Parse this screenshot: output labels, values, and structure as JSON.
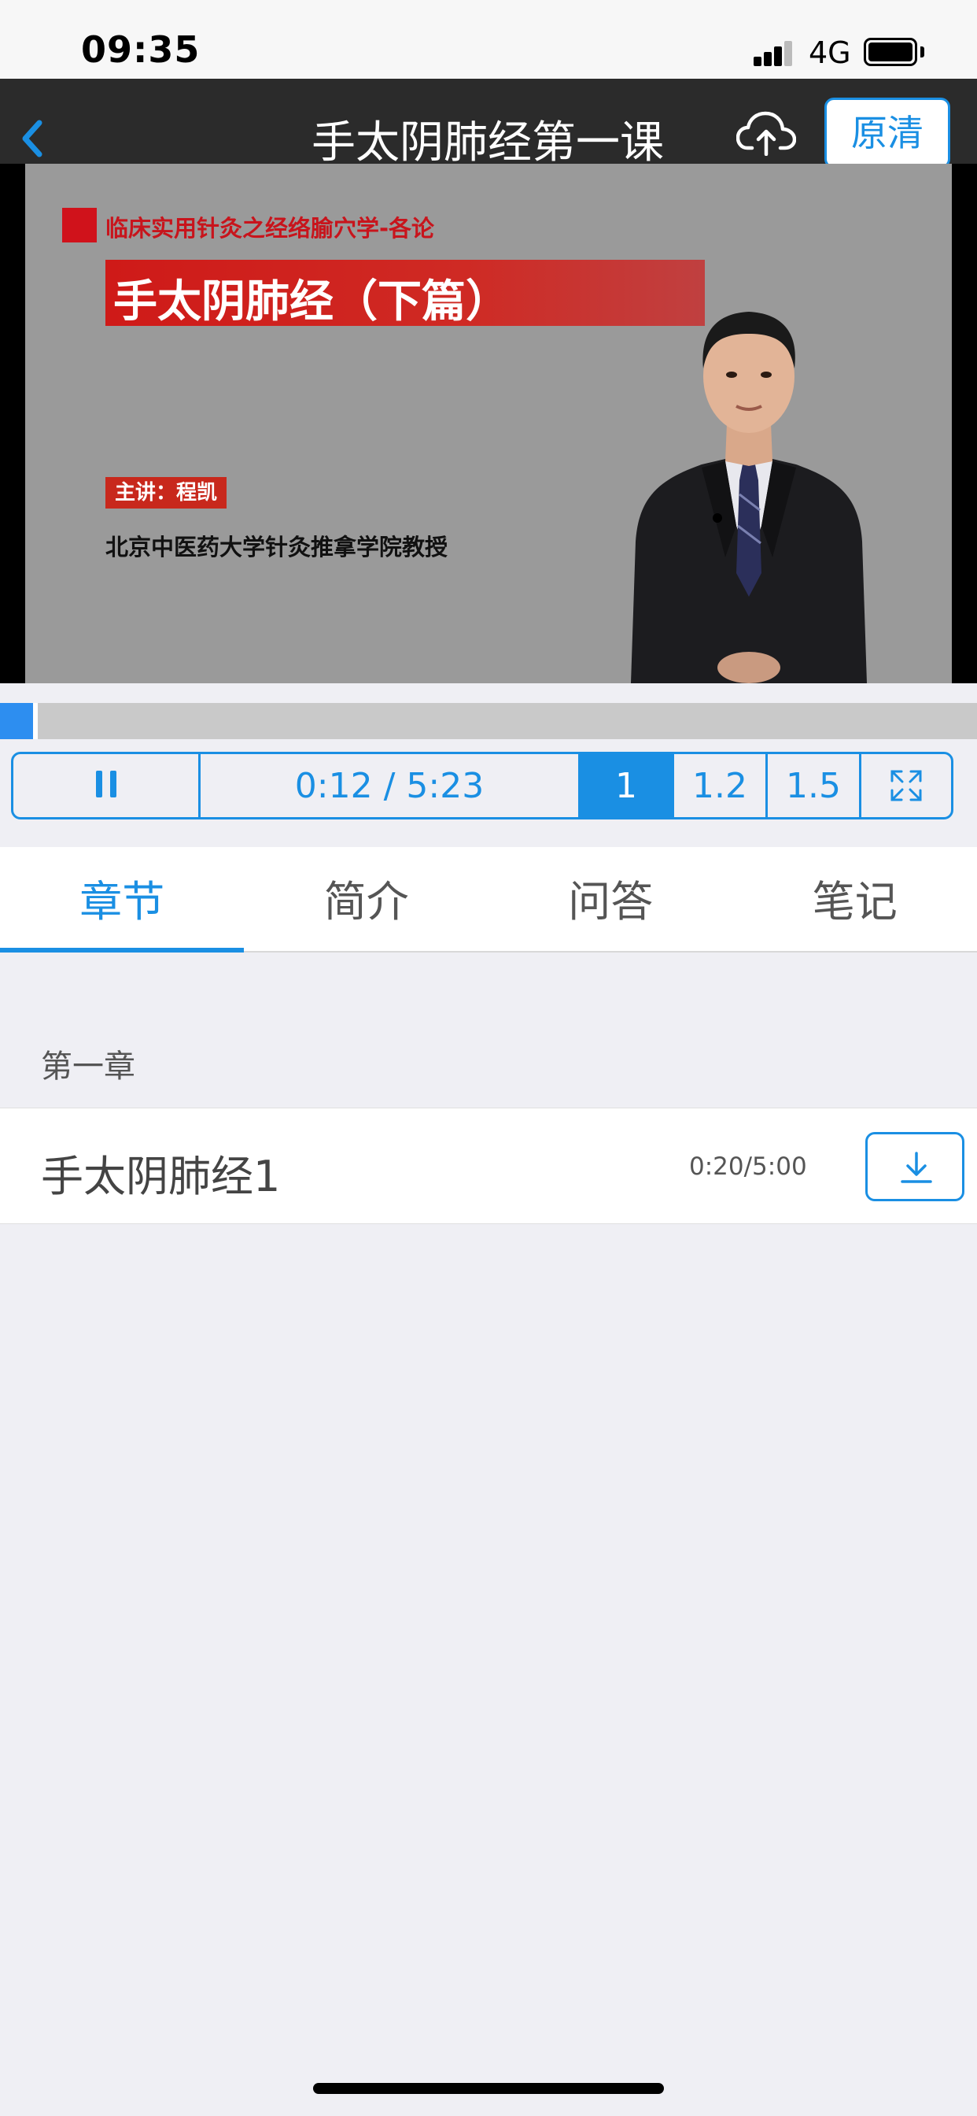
{
  "status_bar": {
    "time": "09:35",
    "network": "4G"
  },
  "nav": {
    "title": "手太阴肺经第一课",
    "quality_label": "原清"
  },
  "video": {
    "slide_subtitle": "临床实用针灸之经络腧穴学-各论",
    "slide_title": "手太阴肺经（下篇）",
    "slide_lecturer": "主讲：程凯",
    "slide_affiliation": "北京中医药大学针灸推拿学院教授",
    "progress_fraction": 0.037
  },
  "controls": {
    "time": "0:12 / 5:23",
    "speeds": [
      "1",
      "1.2",
      "1.5"
    ],
    "selected_speed": "1"
  },
  "tabs": [
    {
      "label": "章节",
      "active": true
    },
    {
      "label": "简介",
      "active": false
    },
    {
      "label": "问答",
      "active": false
    },
    {
      "label": "笔记",
      "active": false
    }
  ],
  "chapters": [
    {
      "title": "第一章",
      "lessons": [
        {
          "title": "手太阴肺经1",
          "progress": "0:20/5:00"
        }
      ]
    }
  ],
  "colors": {
    "accent": "#1a8fe3",
    "navbar": "#2b2b2b",
    "background": "#efeff4",
    "slide_red": "#d0121b"
  },
  "icons": [
    "back-icon",
    "cloud-upload-icon",
    "pause-icon",
    "fullscreen-icon",
    "download-icon"
  ]
}
